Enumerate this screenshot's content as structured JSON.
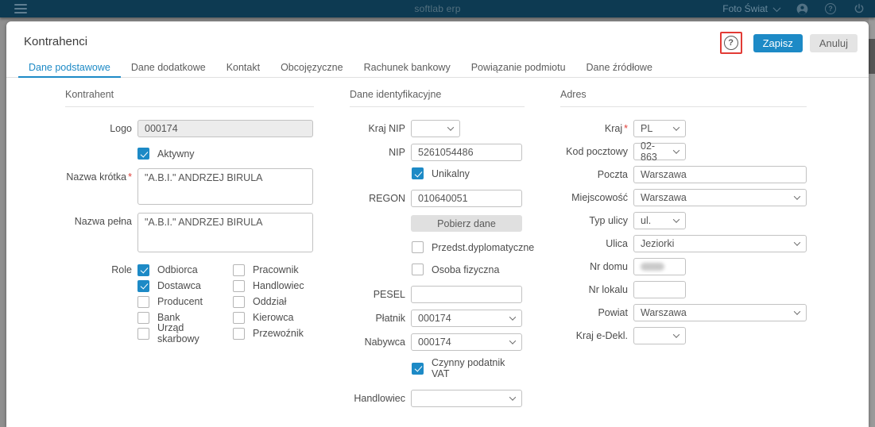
{
  "ui": {
    "required_mark": "*"
  },
  "colors": {
    "topbar_bg": "#0d3a52",
    "accent_blue": "#1d8ac6",
    "annotation_red": "#e23b35"
  },
  "topbar": {
    "app_title": "softlab erp",
    "user_menu_label": "Foto Świat"
  },
  "header": {
    "title": "Kontrahenci",
    "save_label": "Zapisz",
    "cancel_label": "Anuluj",
    "help_glyph": "?"
  },
  "tabs": [
    {
      "label": "Dane podstawowe",
      "active": true
    },
    {
      "label": "Dane dodatkowe",
      "active": false
    },
    {
      "label": "Kontakt",
      "active": false
    },
    {
      "label": "Obcojęzyczne",
      "active": false
    },
    {
      "label": "Rachunek bankowy",
      "active": false
    },
    {
      "label": "Powiązanie podmiotu",
      "active": false
    },
    {
      "label": "Dane źródłowe",
      "active": false
    }
  ],
  "kontrahent": {
    "section_title": "Kontrahent",
    "logo": {
      "label": "Logo",
      "value": "000174",
      "disabled": true
    },
    "aktywny": {
      "label": "Aktywny",
      "checked": true
    },
    "nazwa_krotka": {
      "label": "Nazwa krótka",
      "required": true,
      "value": "\"A.B.I.\" ANDRZEJ BIRULA"
    },
    "nazwa_pelna": {
      "label": "Nazwa pełna",
      "value": "\"A.B.I.\" ANDRZEJ BIRULA"
    },
    "role_label": "Role",
    "role_options": [
      {
        "label": "Odbiorca",
        "checked": true
      },
      {
        "label": "Dostawca",
        "checked": true
      },
      {
        "label": "Producent",
        "checked": false
      },
      {
        "label": "Bank",
        "checked": false
      },
      {
        "label": "Urząd skarbowy",
        "checked": false
      },
      {
        "label": "Pracownik",
        "checked": false
      },
      {
        "label": "Handlowiec",
        "checked": false
      },
      {
        "label": "Oddział",
        "checked": false
      },
      {
        "label": "Kierowca",
        "checked": false
      },
      {
        "label": "Przewoźnik",
        "checked": false
      }
    ]
  },
  "dane_identyfikacyjne": {
    "section_title": "Dane identyfikacyjne",
    "kraj_nip": {
      "label": "Kraj NIP",
      "value": ""
    },
    "nip": {
      "label": "NIP",
      "value": "5261054486"
    },
    "unikalny": {
      "label": "Unikalny",
      "checked": true
    },
    "regon": {
      "label": "REGON",
      "value": "010640051"
    },
    "pobierz_dane_label": "Pobierz dane",
    "przedst_dyplomatyczne": {
      "label": "Przedst.dyplomatyczne",
      "checked": false
    },
    "osoba_fizyczna": {
      "label": "Osoba fizyczna",
      "checked": false
    },
    "pesel": {
      "label": "PESEL",
      "value": ""
    },
    "platnik": {
      "label": "Płatnik",
      "value": "000174"
    },
    "nabywca": {
      "label": "Nabywca",
      "value": "000174"
    },
    "czynny_podatnik_vat": {
      "label": "Czynny podatnik VAT",
      "checked": true
    },
    "handlowiec": {
      "label": "Handlowiec",
      "value": ""
    }
  },
  "adres": {
    "section_title": "Adres",
    "kraj": {
      "label": "Kraj",
      "required": true,
      "value": "PL"
    },
    "kod_pocztowy": {
      "label": "Kod pocztowy",
      "value": "02-863"
    },
    "poczta": {
      "label": "Poczta",
      "value": "Warszawa"
    },
    "miejscowosc": {
      "label": "Miejscowość",
      "value": "Warszawa"
    },
    "typ_ulicy": {
      "label": "Typ ulicy",
      "value": "ul."
    },
    "ulica": {
      "label": "Ulica",
      "value": "Jeziorki"
    },
    "nr_domu": {
      "label": "Nr domu",
      "value": "",
      "redacted": true
    },
    "nr_lokalu": {
      "label": "Nr lokalu",
      "value": ""
    },
    "powiat": {
      "label": "Powiat",
      "value": "Warszawa"
    },
    "kraj_edekl": {
      "label": "Kraj e-Dekl.",
      "value": ""
    }
  }
}
